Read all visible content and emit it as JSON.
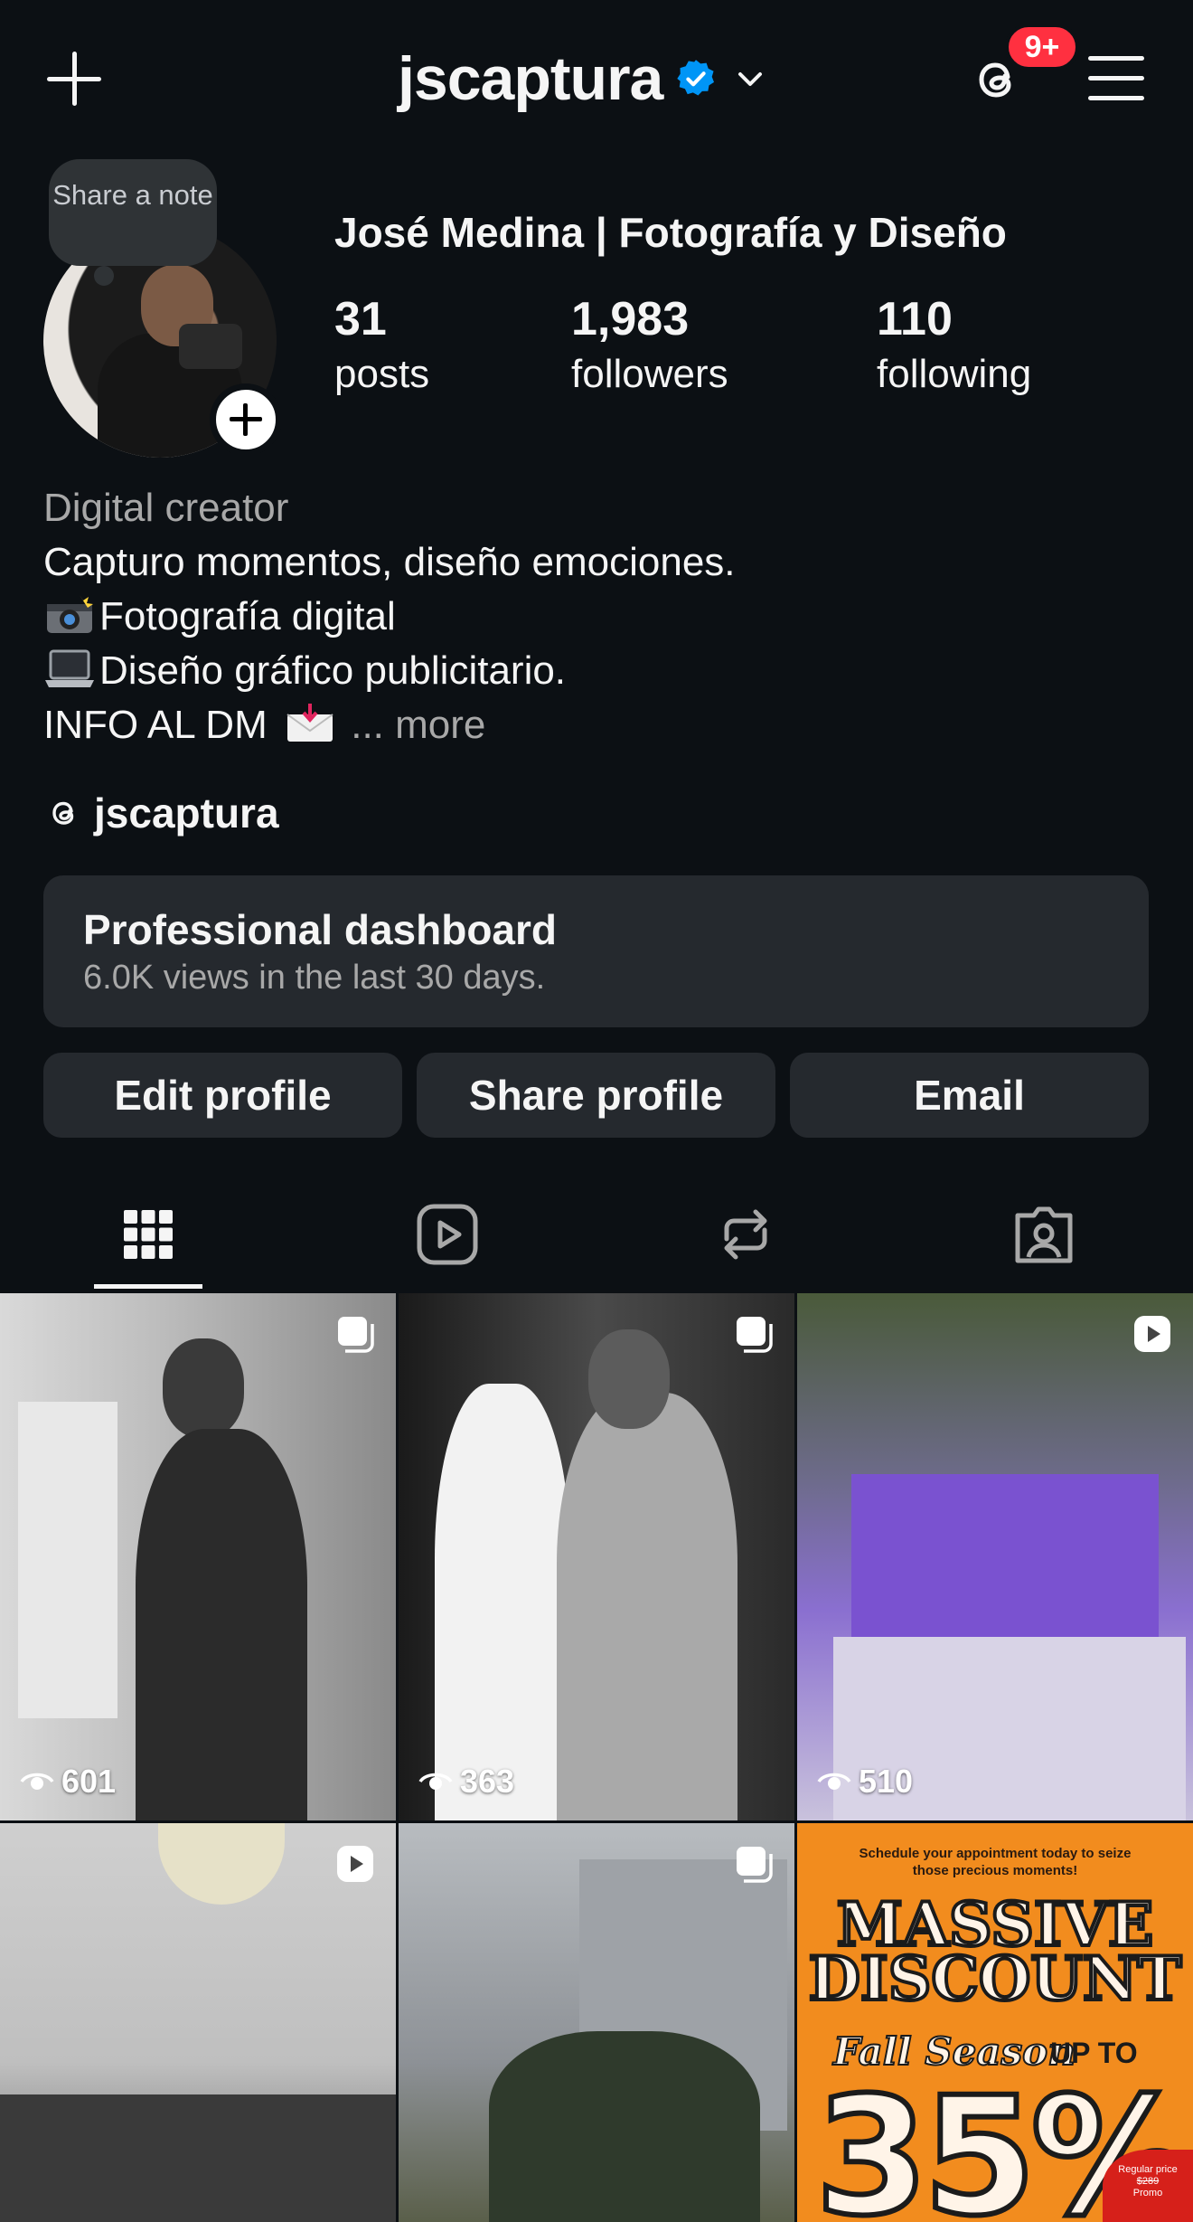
{
  "header": {
    "username": "jscaptura",
    "notification_count": "9+"
  },
  "profile": {
    "note_prompt": "Share a note",
    "full_name": "José Medina | Fotografía y Diseño",
    "stats": {
      "posts_count": "31",
      "posts_label": "posts",
      "followers_count": "1,983",
      "followers_label": "followers",
      "following_count": "110",
      "following_label": "following"
    },
    "bio": {
      "category": "Digital creator",
      "line1": "Capturo momentos, diseño emociones.",
      "line2": "Fotografía digital",
      "line3": "Diseño gráfico publicitario.",
      "line4": "INFO AL DM",
      "more": "... more"
    },
    "threads_handle": "jscaptura"
  },
  "dashboard": {
    "title": "Professional dashboard",
    "subtitle": "6.0K views in the last 30 days."
  },
  "actions": {
    "edit": "Edit profile",
    "share": "Share profile",
    "email": "Email"
  },
  "tabs": [
    "grid-icon",
    "reels-icon",
    "reposts-icon",
    "tagged-icon"
  ],
  "grid": {
    "tile1_views": "601",
    "tile2_views": "363",
    "tile3_views": "510",
    "tile6": {
      "schedule": "Schedule your appointment today to seize those precious moments!",
      "line1": "MASSIVE",
      "line2": "DISCOUNT",
      "fall": "Fall Season",
      "upto": "UP TO",
      "percent": "35%",
      "tag_line1": "Regular price",
      "tag_line2": "$289",
      "tag_line3": "Promo"
    }
  },
  "colors": {
    "background": "#0c1014",
    "surface": "#25292e",
    "text": "#f5f5f5",
    "muted": "#a8a8a8",
    "verified": "#0095f6",
    "badge": "#ff3040"
  }
}
